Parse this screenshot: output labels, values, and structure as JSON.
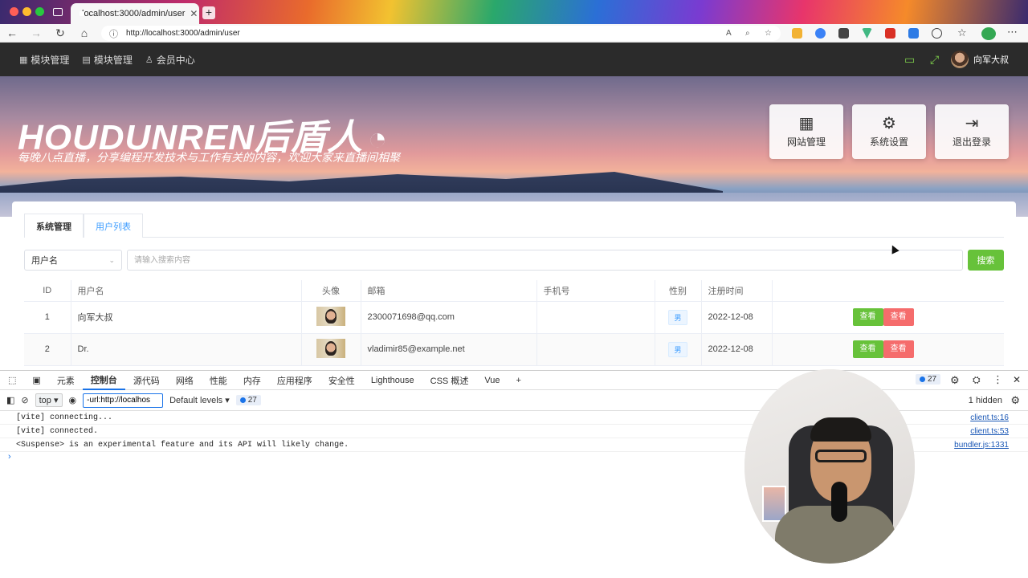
{
  "browser": {
    "tab_title": "localhost:3000/admin/user",
    "tab_close": "✕",
    "new_tab": "+",
    "url": "http://localhost:3000/admin/user"
  },
  "header": {
    "nav": [
      {
        "label": "模块管理",
        "icon": "grid-icon"
      },
      {
        "label": "模块管理",
        "icon": "layers-icon"
      },
      {
        "label": "会员中心",
        "icon": "user-icon"
      }
    ],
    "user_name": "向军大叔"
  },
  "banner": {
    "brand": "HOUDUNREN后盾人",
    "slogan": "每晚八点直播，分享编程开发技术与工作有关的内容，欢迎大家来直播间相聚",
    "quick_buttons": [
      {
        "label": "网站管理",
        "icon": "sitemap-icon"
      },
      {
        "label": "系统设置",
        "icon": "gear-icon"
      },
      {
        "label": "退出登录",
        "icon": "logout-icon"
      }
    ]
  },
  "card": {
    "tabs": [
      "系统管理",
      "用户列表"
    ],
    "search": {
      "field_value": "用户名",
      "placeholder": "请输入搜索内容",
      "button": "搜索"
    },
    "table": {
      "headers": [
        "ID",
        "用户名",
        "头像",
        "邮箱",
        "手机号",
        "性别",
        "注册时间",
        ""
      ],
      "rows": [
        {
          "id": "1",
          "name": "向军大叔",
          "email": "2300071698@qq.com",
          "phone": "",
          "gender": "男",
          "date": "2022-12-08",
          "btn1": "查看",
          "btn2": "查看"
        },
        {
          "id": "2",
          "name": "Dr.",
          "email": "vladimir85@example.net",
          "phone": "",
          "gender": "男",
          "date": "2022-12-08",
          "btn1": "查看",
          "btn2": "查看"
        }
      ]
    }
  },
  "devtools": {
    "tabs": [
      "元素",
      "控制台",
      "源代码",
      "网络",
      "性能",
      "内存",
      "应用程序",
      "安全性",
      "Lighthouse",
      "CSS 概述",
      "Vue"
    ],
    "context": "top",
    "filter_value": "-url:http://localhos",
    "levels": "Default levels",
    "issues_count": "27",
    "hidden": "1 hidden",
    "logs": [
      {
        "text": "[vite] connecting...",
        "src": "client.ts:16"
      },
      {
        "text": "[vite] connected.",
        "src": "client.ts:53"
      },
      {
        "text": "<Suspense> is an experimental feature and its API will likely change.",
        "src": "bundler.js:1331"
      }
    ],
    "prompt": "›"
  },
  "colors": {
    "accent_green": "#67c23a",
    "danger_red": "#f56c6c",
    "link_blue": "#409eff",
    "header_bg": "#2b2b2b"
  }
}
